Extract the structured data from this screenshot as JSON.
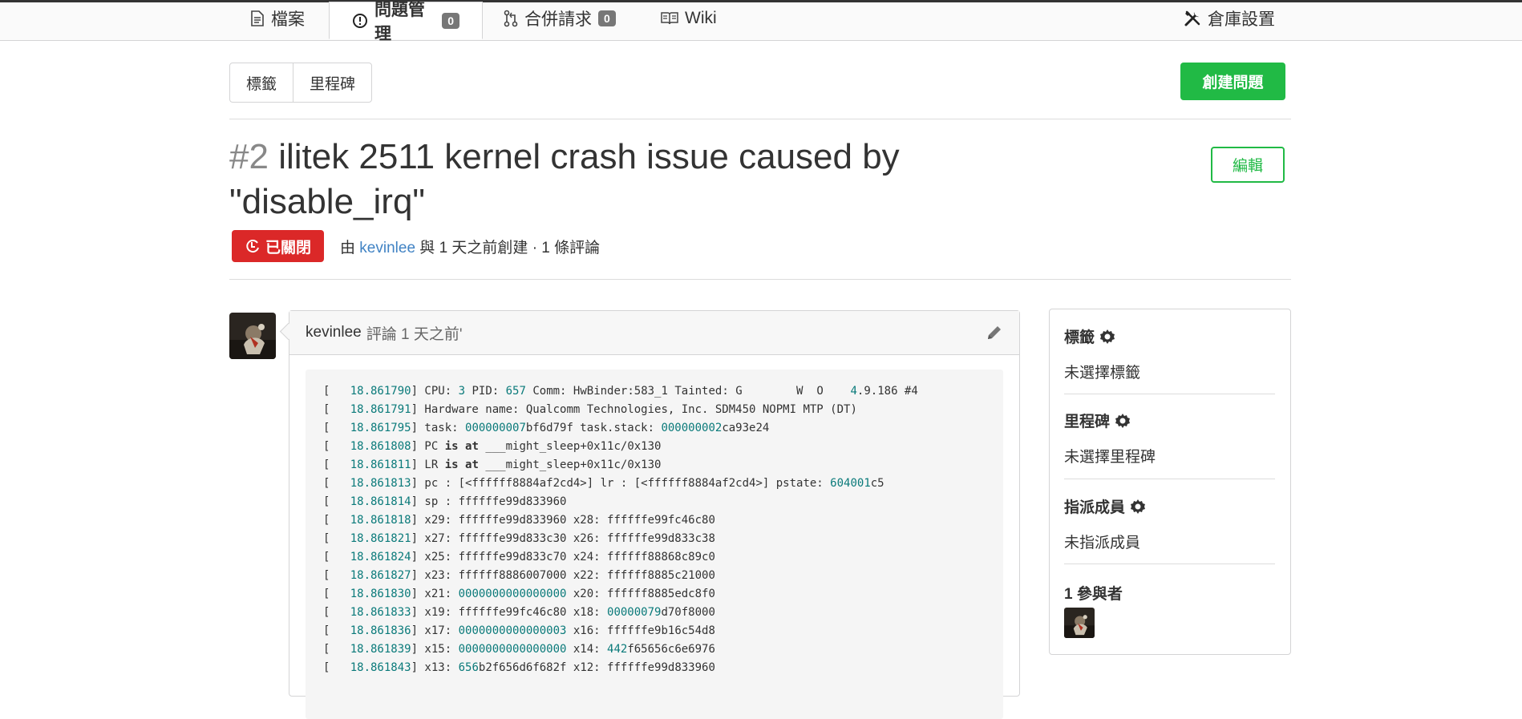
{
  "tabs": [
    {
      "label": "檔案",
      "icon": "file-text-icon"
    },
    {
      "label": "問題管理",
      "icon": "issue-opened-icon",
      "count": "0",
      "active": true
    },
    {
      "label": "合併請求",
      "icon": "git-pull-request-icon",
      "count": "0"
    },
    {
      "label": "Wiki",
      "icon": "book-icon"
    },
    {
      "label": "倉庫設置",
      "icon": "tools-icon"
    }
  ],
  "subnav": {
    "labels": "標籤",
    "milestones": "里程碑"
  },
  "create_issue_label": "創建問題",
  "issue": {
    "index": "#2",
    "title": "ilitek 2511 kernel crash issue caused by \"disable_irq\"",
    "status": "已關閉",
    "meta_prefix": "由",
    "author": "kevinlee",
    "meta_suffix": "與 1 天之前創建 · 1 條評論",
    "edit_label": "編輯"
  },
  "comment": {
    "author": "kevinlee",
    "text": "評論 1 天之前'",
    "log": [
      {
        "ts": "18.861790",
        "msg": "CPU: 3 PID: 657 Comm: HwBinder:583_1 Tainted: G        W  O    4.9.186 #4"
      },
      {
        "ts": "18.861791",
        "msg": "Hardware name: Qualcomm Technologies, Inc. SDM450 NOPMI MTP (DT)"
      },
      {
        "ts": "18.861795",
        "msg": "task: 000000007bf6d79f task.stack: 000000002ca93e24"
      },
      {
        "ts": "18.861808",
        "msg": "PC is at ___might_sleep+0x11c/0x130"
      },
      {
        "ts": "18.861811",
        "msg": "LR is at ___might_sleep+0x11c/0x130"
      },
      {
        "ts": "18.861813",
        "msg": "pc : [<ffffff8884af2cd4>] lr : [<ffffff8884af2cd4>] pstate: 604001c5"
      },
      {
        "ts": "18.861814",
        "msg": "sp : ffffffe99d833960"
      },
      {
        "ts": "18.861818",
        "msg": "x29: ffffffe99d833960 x28: ffffffe99fc46c80"
      },
      {
        "ts": "18.861821",
        "msg": "x27: ffffffe99d833c30 x26: ffffffe99d833c38"
      },
      {
        "ts": "18.861824",
        "msg": "x25: ffffffe99d833c70 x24: ffffff88868c89c0"
      },
      {
        "ts": "18.861827",
        "msg": "x23: ffffff8886007000 x22: ffffff8885c21000"
      },
      {
        "ts": "18.861830",
        "msg": "x21: 0000000000000000 x20: ffffff8885edc8f0"
      },
      {
        "ts": "18.861833",
        "msg": "x19: ffffffe99fc46c80 x18: 00000079d70f8000"
      },
      {
        "ts": "18.861836",
        "msg": "x17: 0000000000000003 x16: ffffffe9b16c54d8"
      },
      {
        "ts": "18.861839",
        "msg": "x15: 0000000000000000 x14: 442f65656c6e6976"
      },
      {
        "ts": "18.861843",
        "msg": "x13: 656b2f656d6f682f x12: ffffffe99d833960"
      }
    ]
  },
  "sidebar": {
    "labels_title": "標籤",
    "labels_value": "未選擇標籤",
    "milestone_title": "里程碑",
    "milestone_value": "未選擇里程碑",
    "assignees_title": "指派成員",
    "assignees_value": "未指派成員",
    "participants_title": "1 參與者"
  },
  "colors": {
    "green": "#21ba45",
    "red": "#db2828",
    "link": "#4183c4",
    "number": "#0a7a7a"
  }
}
